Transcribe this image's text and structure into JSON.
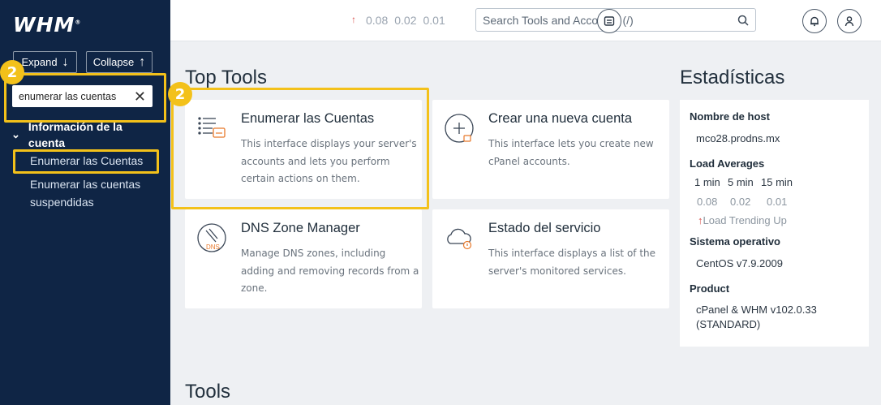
{
  "sidebar": {
    "logo": "WHM",
    "logo_mark": "®",
    "expand_label": "Expand",
    "collapse_label": "Collapse",
    "search_value": "enumerar las cuentas",
    "category_label": "Información de la cuenta",
    "items": [
      {
        "label": "Enumerar las Cuentas"
      },
      {
        "label": "Enumerar las cuentas suspendidas"
      }
    ],
    "step_badge": "2"
  },
  "topbar": {
    "load": [
      "0.08",
      "0.02",
      "0.01"
    ],
    "search_placeholder": "Search Tools and Accounts (/)"
  },
  "main": {
    "top_tools_title": "Top Tools",
    "tools_title": "Tools",
    "step_badge": "2",
    "cards": [
      {
        "title": "Enumerar las Cuentas",
        "desc": "This interface displays your server's accounts and lets you perform certain actions on them.",
        "icon": "list-accounts-icon"
      },
      {
        "title": "Crear una nueva cuenta",
        "desc": "This interface lets you create new cPanel accounts.",
        "icon": "create-account-icon"
      },
      {
        "title": "DNS Zone Manager",
        "desc": "Manage DNS zones, including adding and removing records from a zone.",
        "icon": "dns-icon"
      },
      {
        "title": "Estado del servicio",
        "desc": "This interface displays a list of the server's monitored services.",
        "icon": "service-status-icon"
      }
    ]
  },
  "stats": {
    "title": "Estadísticas",
    "hostname_label": "Nombre de host",
    "hostname": "mco28.prodns.mx",
    "load_label": "Load Averages",
    "load_headers": [
      "1 min",
      "5 min",
      "15 min"
    ],
    "load_values": [
      "0.08",
      "0.02",
      "0.01"
    ],
    "load_trend": "Load Trending Up",
    "os_label": "Sistema operativo",
    "os": "CentOS v7.9.2009",
    "product_label": "Product",
    "product": "cPanel & WHM v102.0.33 (STANDARD)"
  },
  "colors": {
    "sidebar_bg": "#0f2545",
    "highlight": "#f3c11a",
    "accent_orange": "#e8792b",
    "trend_red": "#d9534f"
  }
}
